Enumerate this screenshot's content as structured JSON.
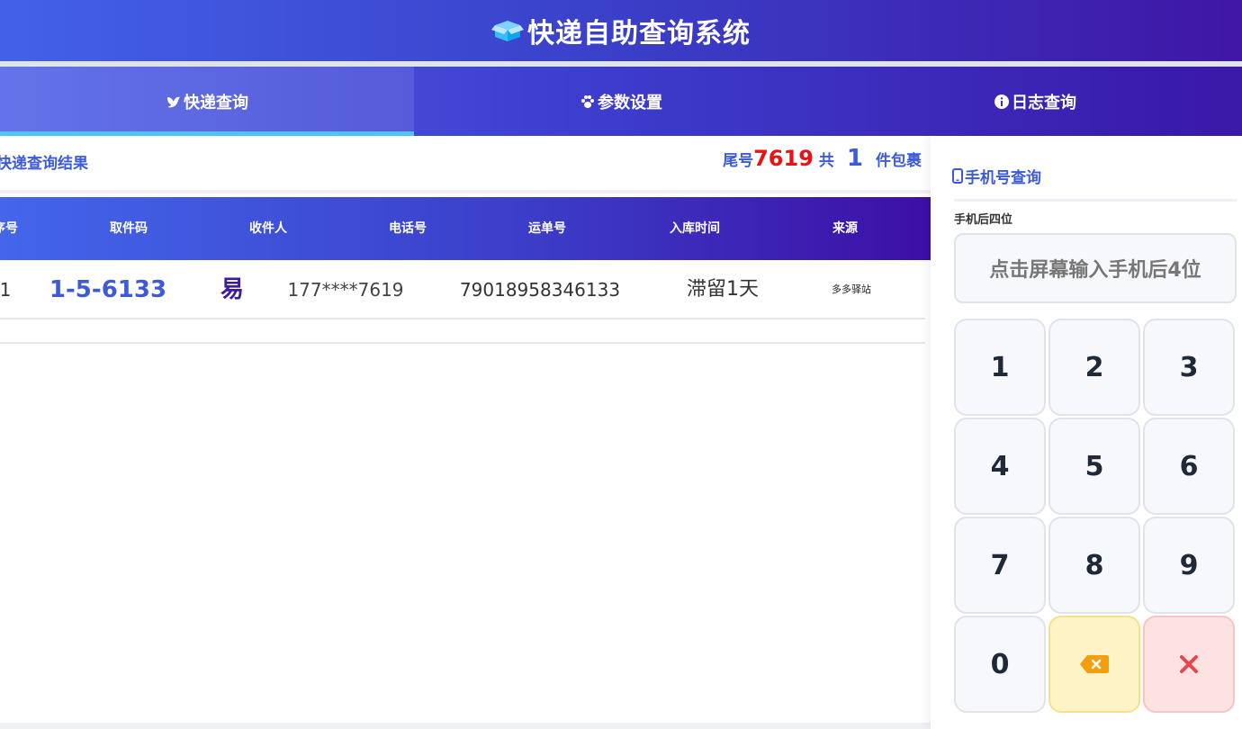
{
  "header": {
    "title": "快递自助查询系统"
  },
  "tabs": [
    {
      "label": "快递查询",
      "active": true
    },
    {
      "label": "参数设置",
      "active": false
    },
    {
      "label": "日志查询",
      "active": false
    }
  ],
  "result": {
    "title": "快递查询结果",
    "tail_prefix": "尾号",
    "tail_number": "7619",
    "total_prefix": "共",
    "count": "1",
    "count_suffix": "件包裹"
  },
  "table": {
    "columns": [
      "序号",
      "取件码",
      "收件人",
      "电话号",
      "运单号",
      "入库时间",
      "来源"
    ],
    "rows": [
      {
        "seq": "1",
        "pickup_code": "1-5-6133",
        "recipient": "易",
        "phone": "177****7619",
        "waybill": "79018958346133",
        "time": "滞留1天",
        "source": "多多驿站"
      }
    ]
  },
  "side": {
    "title": "手机号查询",
    "field_label": "手机后四位",
    "input_placeholder": "点击屏幕输入手机后4位",
    "keys": [
      "1",
      "2",
      "3",
      "4",
      "5",
      "6",
      "7",
      "8",
      "9",
      "0"
    ]
  },
  "colors": {
    "accent": "#3d5bd9",
    "header_start": "#4361e8",
    "header_end": "#3f16a6",
    "tail_red": "#e11111",
    "tab_underline": "#4fc3f7"
  },
  "icons": [
    "box-icon",
    "dove-icon",
    "paw-icon",
    "info-icon",
    "mobile-icon",
    "backspace-icon",
    "close-icon"
  ]
}
